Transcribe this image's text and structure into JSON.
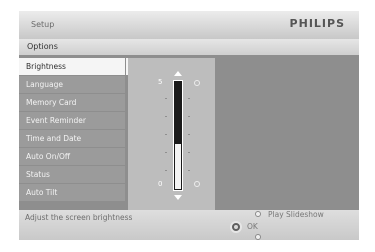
{
  "header": {
    "section": "Setup",
    "brand": "PHILIPS"
  },
  "options_bar": {
    "label": "Options"
  },
  "menu": {
    "items": [
      {
        "label": "Brightness",
        "selected": true
      },
      {
        "label": "Language"
      },
      {
        "label": "Memory Card"
      },
      {
        "label": "Event Reminder"
      },
      {
        "label": "Time and Date"
      },
      {
        "label": "Auto On/Off"
      },
      {
        "label": "Status"
      },
      {
        "label": "Auto Tilt"
      }
    ]
  },
  "brightness": {
    "max_label": "5",
    "min_label": "0",
    "level": 0.42
  },
  "footer": {
    "hint": "Adjust the screen brightness",
    "play_label": "Play Slideshow",
    "ok_label": "OK"
  }
}
